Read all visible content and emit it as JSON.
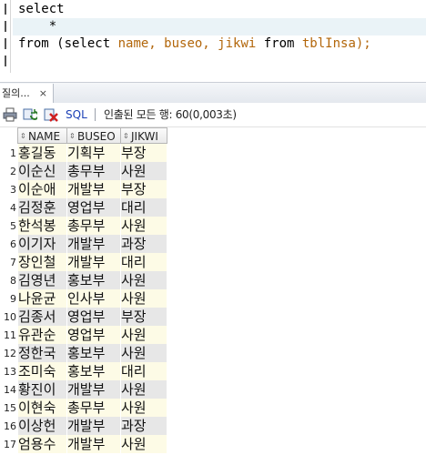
{
  "editor": {
    "lines": [
      "select",
      "    *",
      "from (select name, buseo, jikwi from tblInsa);"
    ],
    "line3": {
      "kw_from": "from",
      "open": " (",
      "kw_select": "select",
      "cols": " name, buseo, jikwi ",
      "kw_from2": "from",
      "table": " tblInsa);"
    }
  },
  "results_tab": {
    "label": "질의...",
    "close_glyph": "×"
  },
  "toolbar": {
    "icons": [
      "print-icon",
      "refresh-icon",
      "cancel-query-icon"
    ],
    "sql_label": "SQL",
    "status": "인출된 모든 행: 60(0,003초)"
  },
  "grid": {
    "columns": [
      "NAME",
      "BUSEO",
      "JIKWI"
    ],
    "sort_glyph": "⇕",
    "rows": [
      {
        "n": "1",
        "name": "홍길동",
        "buseo": "기획부",
        "jikwi": "부장"
      },
      {
        "n": "2",
        "name": "이순신",
        "buseo": "총무부",
        "jikwi": "사원"
      },
      {
        "n": "3",
        "name": "이순애",
        "buseo": "개발부",
        "jikwi": "부장"
      },
      {
        "n": "4",
        "name": "김정훈",
        "buseo": "영업부",
        "jikwi": "대리"
      },
      {
        "n": "5",
        "name": "한석봉",
        "buseo": "총무부",
        "jikwi": "사원"
      },
      {
        "n": "6",
        "name": "이기자",
        "buseo": "개발부",
        "jikwi": "과장"
      },
      {
        "n": "7",
        "name": "장인철",
        "buseo": "개발부",
        "jikwi": "대리"
      },
      {
        "n": "8",
        "name": "김영년",
        "buseo": "홍보부",
        "jikwi": "사원"
      },
      {
        "n": "9",
        "name": "나윤균",
        "buseo": "인사부",
        "jikwi": "사원"
      },
      {
        "n": "10",
        "name": "김종서",
        "buseo": "영업부",
        "jikwi": "부장"
      },
      {
        "n": "11",
        "name": "유관순",
        "buseo": "영업부",
        "jikwi": "사원"
      },
      {
        "n": "12",
        "name": "정한국",
        "buseo": "홍보부",
        "jikwi": "사원"
      },
      {
        "n": "13",
        "name": "조미숙",
        "buseo": "홍보부",
        "jikwi": "대리"
      },
      {
        "n": "14",
        "name": "황진이",
        "buseo": "개발부",
        "jikwi": "사원"
      },
      {
        "n": "15",
        "name": "이현숙",
        "buseo": "총무부",
        "jikwi": "사원"
      },
      {
        "n": "16",
        "name": "이상헌",
        "buseo": "개발부",
        "jikwi": "과장"
      },
      {
        "n": "17",
        "name": "엄용수",
        "buseo": "개발부",
        "jikwi": "사원"
      }
    ]
  },
  "colors": {
    "row_odd": "#fdfbe6",
    "row_even": "#e7e7e7",
    "keyword": "#b2660a",
    "link": "#1a3fb5"
  }
}
